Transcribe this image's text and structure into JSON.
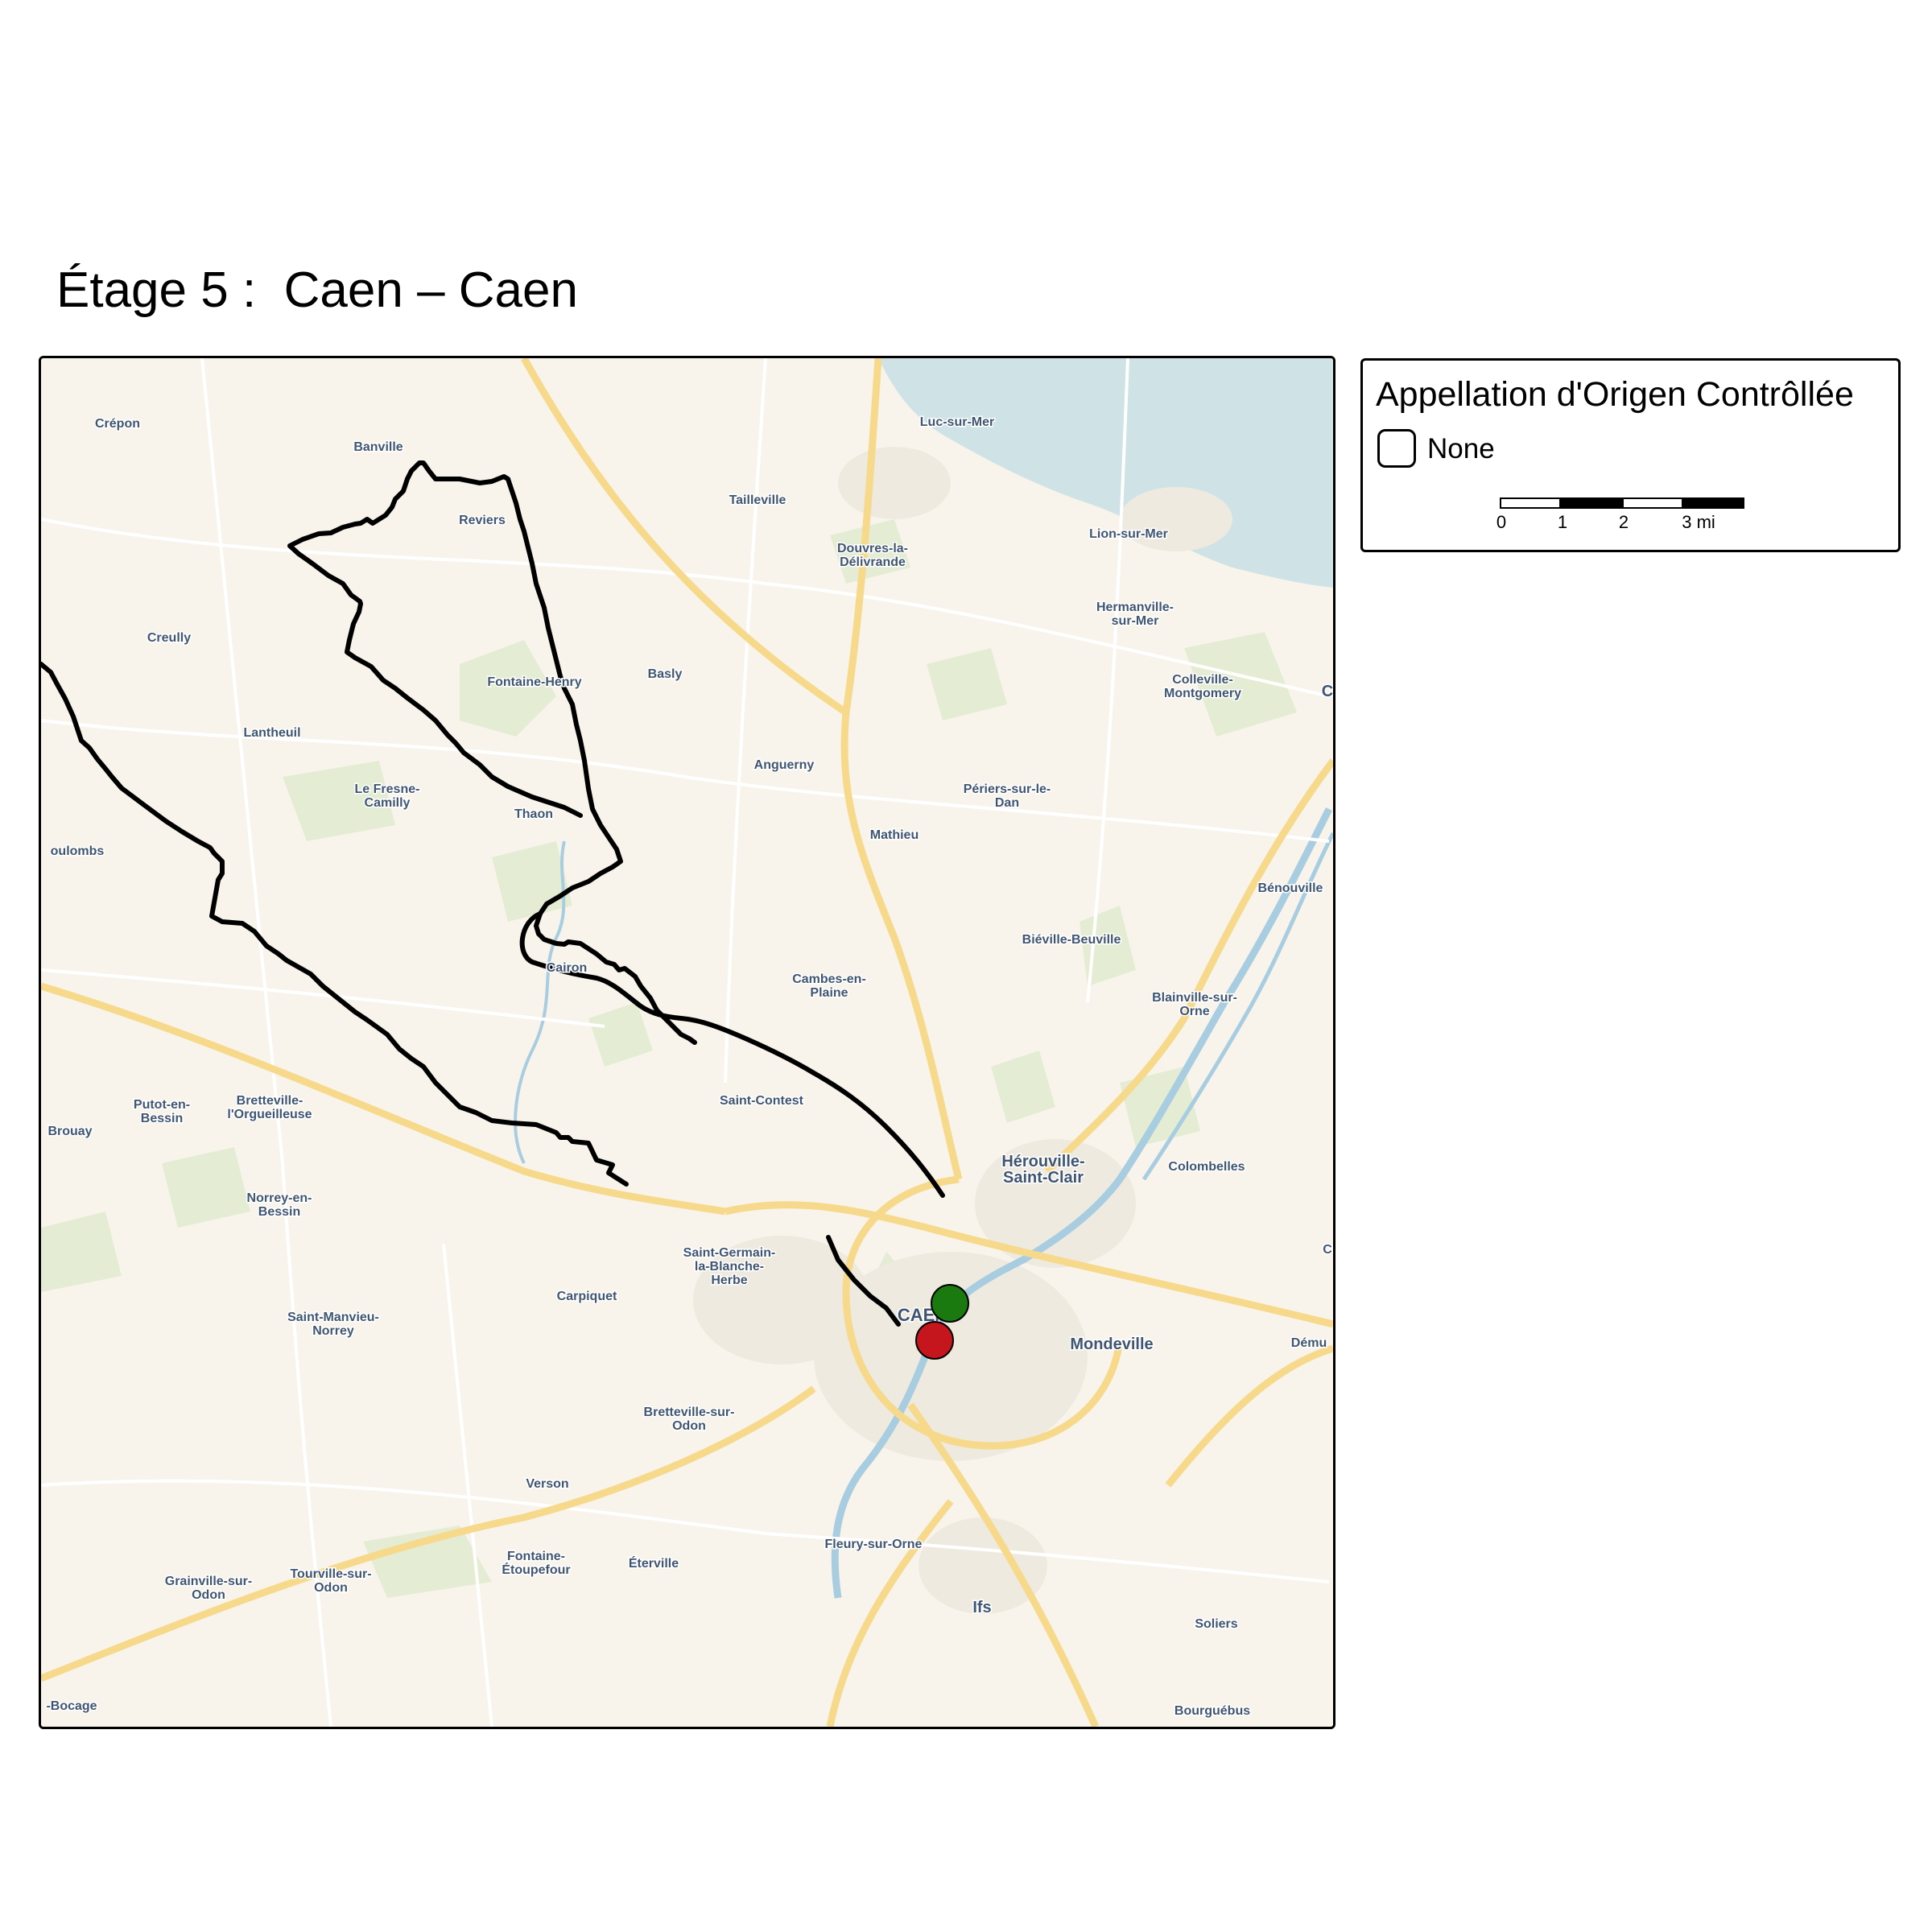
{
  "title": "Étage 5 :  Caen – Caen",
  "legend": {
    "title": "Appellation d'Origen Contrôllée",
    "items": [
      {
        "label": "None",
        "fill": "#ffffff"
      }
    ],
    "scale": {
      "ticks": [
        "0",
        "1",
        "2",
        "3 mi"
      ]
    }
  },
  "map": {
    "colors": {
      "land": "#f8f4ec",
      "sea": "#cfe3e6",
      "river": "#a9cde0",
      "green": "#e4ecd3",
      "urban": "#efeae0",
      "road_major": "#f7d98b",
      "road_minor": "#ffffff",
      "route": "#000000",
      "start_marker": "#1a7a10",
      "finish_marker": "#c4161c"
    },
    "start_marker": "green",
    "finish_marker": "red",
    "places": [
      {
        "name": "Crépon"
      },
      {
        "name": "Banville"
      },
      {
        "name": "Luc-sur-Mer"
      },
      {
        "name": "Tailleville"
      },
      {
        "name": "Reviers"
      },
      {
        "name": "Lion-sur-Mer"
      },
      {
        "name": "Douvres-la-"
      },
      {
        "name": "Délivrande"
      },
      {
        "name": "Creully"
      },
      {
        "name": "Hermanville-"
      },
      {
        "name": "sur-Mer"
      },
      {
        "name": "Basly"
      },
      {
        "name": "Fontaine-Henry"
      },
      {
        "name": "Colleville-"
      },
      {
        "name": "Montgomery"
      },
      {
        "name": "Lantheuil"
      },
      {
        "name": "Anguerny"
      },
      {
        "name": "Périers-sur-le-"
      },
      {
        "name": "Dan"
      },
      {
        "name": "Le Fresne-"
      },
      {
        "name": "Camilly"
      },
      {
        "name": "Thaon"
      },
      {
        "name": "Mathieu"
      },
      {
        "name": "oulombs"
      },
      {
        "name": "Bénouville"
      },
      {
        "name": "Biéville-Beuville"
      },
      {
        "name": "Cairon"
      },
      {
        "name": "Cambes-en-"
      },
      {
        "name": "Plaine"
      },
      {
        "name": "Blainville-sur-"
      },
      {
        "name": "Orne"
      },
      {
        "name": "Saint-Contest"
      },
      {
        "name": "Bretteville-"
      },
      {
        "name": "l'Orgueilleuse"
      },
      {
        "name": "Putot-en-"
      },
      {
        "name": "Bessin"
      },
      {
        "name": "Brouay"
      },
      {
        "name": "Hérouville-"
      },
      {
        "name": "Saint-Clair"
      },
      {
        "name": "Colombelles"
      },
      {
        "name": "Norrey-en-"
      },
      {
        "name": "Bessin"
      },
      {
        "name": "Saint-Germain-"
      },
      {
        "name": "la-Blanche-"
      },
      {
        "name": "Herbe"
      },
      {
        "name": "Carpiquet"
      },
      {
        "name": "CAEN"
      },
      {
        "name": "Saint-Manvieu-"
      },
      {
        "name": "Norrey"
      },
      {
        "name": "Mondeville"
      },
      {
        "name": "Dému"
      },
      {
        "name": "Bretteville-sur-"
      },
      {
        "name": "Odon"
      },
      {
        "name": "Verson"
      },
      {
        "name": "Fontaine-"
      },
      {
        "name": "Étoupefour"
      },
      {
        "name": "Éterville"
      },
      {
        "name": "Fleury-sur-Orne"
      },
      {
        "name": "Grainville-sur-"
      },
      {
        "name": "Odon"
      },
      {
        "name": "Tourville-sur-"
      },
      {
        "name": "Odon"
      },
      {
        "name": "Ifs"
      },
      {
        "name": "Soliers"
      },
      {
        "name": "-Bocage"
      },
      {
        "name": "Bourguébus"
      },
      {
        "name": "C"
      },
      {
        "name": "C"
      }
    ]
  }
}
